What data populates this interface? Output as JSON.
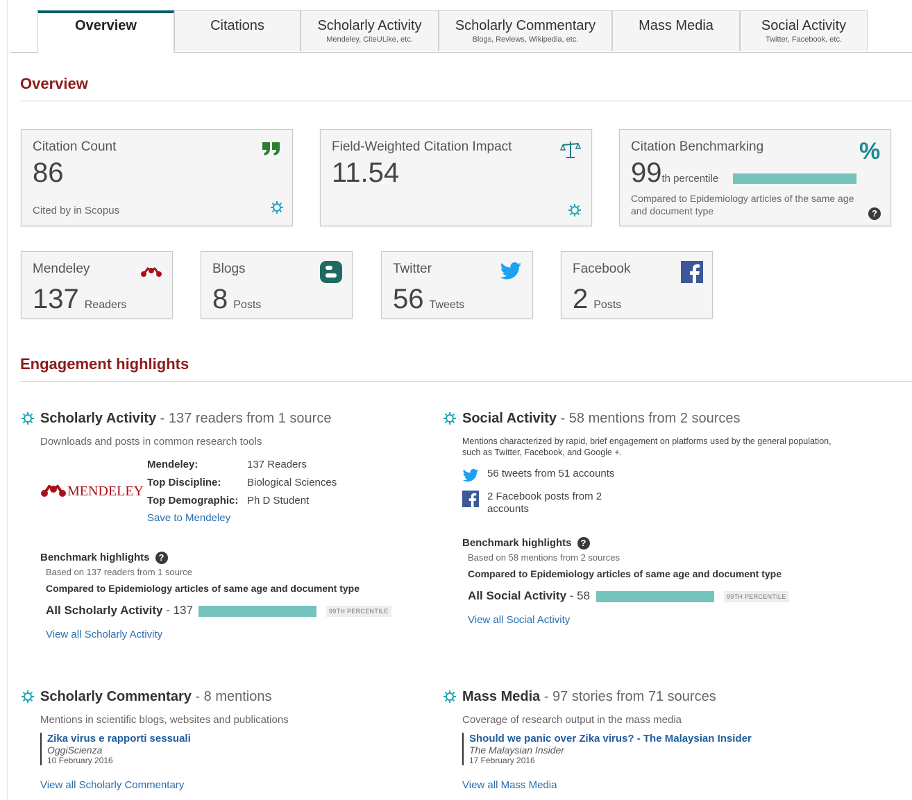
{
  "tabs": [
    {
      "label": "Overview",
      "sub": ""
    },
    {
      "label": "Citations",
      "sub": ""
    },
    {
      "label": "Scholarly Activity",
      "sub": "Mendeley, CiteULike, etc."
    },
    {
      "label": "Scholarly Commentary",
      "sub": "Blogs, Reviews, Wikipedia, etc."
    },
    {
      "label": "Mass Media",
      "sub": ""
    },
    {
      "label": "Social Activity",
      "sub": "Twitter, Facebook, etc."
    }
  ],
  "overview_title": "Overview",
  "cards": {
    "citation_count": {
      "title": "Citation Count",
      "value": "86",
      "foot": "Cited by in Scopus",
      "icon": "quote-icon"
    },
    "fwci": {
      "title": "Field-Weighted Citation Impact",
      "value": "11.54",
      "icon": "scales-icon"
    },
    "benchmarking": {
      "title": "Citation Benchmarking",
      "value": "99",
      "suffix": "th percentile",
      "percentile": 99,
      "foot": "Compared to Epidemiology articles of the same age and document type",
      "icon": "percent-icon"
    }
  },
  "small_cards": [
    {
      "title": "Mendeley",
      "value": "137",
      "unit": "Readers",
      "icon": "mendeley-icon"
    },
    {
      "title": "Blogs",
      "value": "8",
      "unit": "Posts",
      "icon": "blogger-icon"
    },
    {
      "title": "Twitter",
      "value": "56",
      "unit": "Tweets",
      "icon": "twitter-icon"
    },
    {
      "title": "Facebook",
      "value": "2",
      "unit": "Posts",
      "icon": "facebook-icon"
    }
  ],
  "engagement_title": "Engagement highlights",
  "scholarly": {
    "title": "Scholarly Activity",
    "summary": "- 137 readers from 1 source",
    "desc": "Downloads and posts in common research tools",
    "logo_text": "MENDELEY",
    "rows": [
      {
        "label": "Mendeley:",
        "value": "137 Readers"
      },
      {
        "label": "Top Discipline:",
        "value": "Biological Sciences"
      },
      {
        "label": "Top Demographic:",
        "value": "Ph D Student"
      }
    ],
    "save_link": "Save to Mendeley",
    "bm_title": "Benchmark highlights",
    "bm_sub": "Based on 137 readers from 1 source",
    "bm_cmp": "Compared to Epidemiology articles of same age and document type",
    "bm_label": "All Scholarly Activity",
    "bm_value": "- 137",
    "bm_pct_label": "99TH PERCENTILE",
    "percentile": 99,
    "view_all": "View all Scholarly Activity"
  },
  "social": {
    "title": "Social Activity",
    "summary": "- 58 mentions from 2 sources",
    "desc": "Mentions characterized by rapid, brief engagement on platforms used by the general population, such as Twitter, Facebook, and Google +.",
    "tweets": "56 tweets from 51 accounts",
    "facebook": "2 Facebook posts from 2 accounts",
    "bm_title": "Benchmark highlights",
    "bm_sub": "Based on 58 mentions from 2 sources",
    "bm_cmp": "Compared to Epidemiology articles of same age and document type",
    "bm_label": "All Social Activity",
    "bm_value": "- 58",
    "bm_pct_label": "99TH PERCENTILE",
    "percentile": 99,
    "view_all": "View all Social Activity"
  },
  "commentary": {
    "title": "Scholarly Commentary",
    "summary": "- 8 mentions",
    "desc": "Mentions in scientific blogs, websites and publications",
    "story_title": "Zika virus e rapporti sessuali",
    "story_src": "OggiScienza",
    "story_date": "10 February 2016",
    "view_all": "View all Scholarly Commentary"
  },
  "media": {
    "title": "Mass Media",
    "summary": "- 97 stories from 71 sources",
    "desc": "Coverage of research output in the mass media",
    "story_title": "Should we panic over Zika virus? - The Malaysian Insider",
    "story_src": "The Malaysian Insider",
    "story_date": "17 February 2016",
    "view_all": "View all Mass Media"
  },
  "colors": {
    "accent": "#8e1b1b",
    "teal": "#74c3bd",
    "tab_active": "#005e6e",
    "link": "#2a6db0",
    "mendeley_red": "#a8101c",
    "twitter": "#1da1f2",
    "facebook": "#3b5998"
  }
}
